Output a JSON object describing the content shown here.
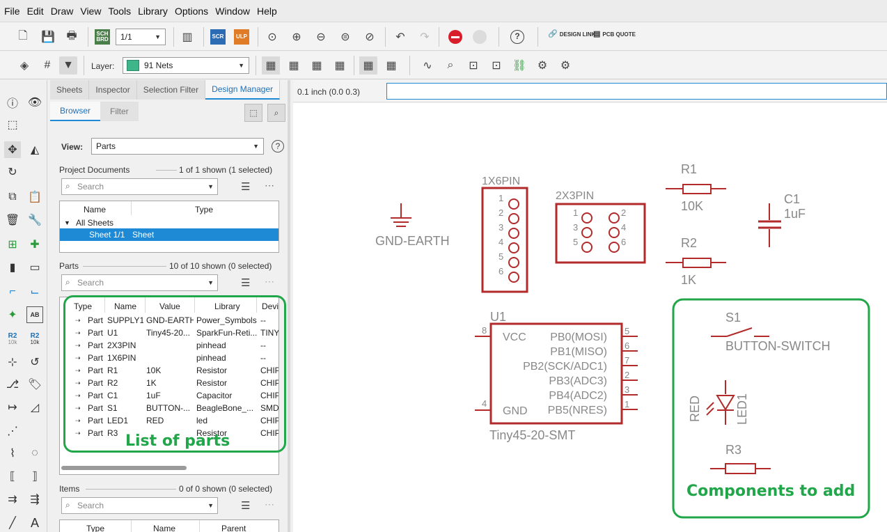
{
  "menu": [
    "File",
    "Edit",
    "Draw",
    "View",
    "Tools",
    "Library",
    "Options",
    "Window",
    "Help"
  ],
  "toolbar": {
    "sheet_value": "1/1",
    "sch_brd": "SCH BRD",
    "scr": "SCR",
    "ulp": "ULP",
    "design_link": "DESIGN LINK",
    "pcb_quote": "PCB QUOTE",
    "layer_label": "Layer:",
    "layer_value": "91 Nets",
    "layer_color": "#3fb58c"
  },
  "coord": "0.1 inch (0.0 0.3)",
  "lefttools": {
    "r2_label": "R2",
    "r2_sub": "10k",
    "ab_label": "AB"
  },
  "panel": {
    "tabs": [
      "Sheets",
      "Inspector",
      "Selection Filter",
      "Design Manager"
    ],
    "subtabs": [
      "Browser",
      "Filter"
    ],
    "view_label": "View:",
    "view_value": "Parts",
    "project_documents": {
      "title": "Project Documents",
      "count": "1 of 1 shown (1 selected)",
      "search_placeholder": "Search",
      "col_name": "Name",
      "col_type": "Type",
      "group": "All Sheets",
      "sheet_name": "Sheet 1/1",
      "sheet_type": "Sheet"
    },
    "parts": {
      "title": "Parts",
      "count": "10 of 10 shown (0 selected)",
      "search_placeholder": "Search",
      "columns": [
        "Type",
        "Name",
        "Value",
        "Library",
        "Devi"
      ],
      "rows": [
        {
          "type": "Part",
          "name": "SUPPLY1",
          "value": "GND-EARTH",
          "library": "Power_Symbols",
          "device": "--"
        },
        {
          "type": "Part",
          "name": "U1",
          "value": "Tiny45-20...",
          "library": "SparkFun-Reti...",
          "device": "TINY"
        },
        {
          "type": "Part",
          "name": "2X3PIN",
          "value": "",
          "library": "pinhead",
          "device": "--"
        },
        {
          "type": "Part",
          "name": "1X6PIN",
          "value": "",
          "library": "pinhead",
          "device": "--"
        },
        {
          "type": "Part",
          "name": "R1",
          "value": "10K",
          "library": "Resistor",
          "device": "CHIP"
        },
        {
          "type": "Part",
          "name": "R2",
          "value": "1K",
          "library": "Resistor",
          "device": "CHIP"
        },
        {
          "type": "Part",
          "name": "C1",
          "value": "1uF",
          "library": "Capacitor",
          "device": "CHIP"
        },
        {
          "type": "Part",
          "name": "S1",
          "value": "BUTTON-...",
          "library": "BeagleBone_...",
          "device": "SMD-"
        },
        {
          "type": "Part",
          "name": "LED1",
          "value": "RED",
          "library": "led",
          "device": "CHIP"
        },
        {
          "type": "Part",
          "name": "R3",
          "value": "",
          "library": "Resistor",
          "device": "CHIP"
        }
      ]
    },
    "items": {
      "title": "Items",
      "count": "0 of 0 shown (0 selected)",
      "search_placeholder": "Search",
      "columns": [
        "Type",
        "Name",
        "Parent"
      ]
    }
  },
  "schematic": {
    "gnd": "GND-EARTH",
    "x1x6": "1X6PIN",
    "x1x6_pins": [
      "1",
      "2",
      "3",
      "4",
      "5",
      "6"
    ],
    "x2x3": "2X3PIN",
    "x2x3_pins": [
      "1",
      "2",
      "3",
      "4",
      "5",
      "6"
    ],
    "r1": "R1",
    "r1_val": "10K",
    "r2": "R2",
    "r2_val": "1K",
    "c1": "C1",
    "c1_val": "1uF",
    "u1": "U1",
    "u1_val": "Tiny45-20-SMT",
    "u1_left": [
      "VCC",
      "GND"
    ],
    "u1_left_nums": [
      "8",
      "4"
    ],
    "u1_right": [
      "PB0(MOSI)",
      "PB1(MISO)",
      "PB2(SCK/ADC1)",
      "PB3(ADC3)",
      "PB4(ADC2)",
      "PB5(NRES)"
    ],
    "u1_right_nums": [
      "5",
      "6",
      "7",
      "2",
      "3",
      "1"
    ],
    "s1": "S1",
    "s1_val": "BUTTON-SWITCH",
    "led": "LED1",
    "led_val": "RED",
    "r3": "R3"
  },
  "annotations": {
    "parts": "List of parts",
    "components": "Components to add"
  }
}
